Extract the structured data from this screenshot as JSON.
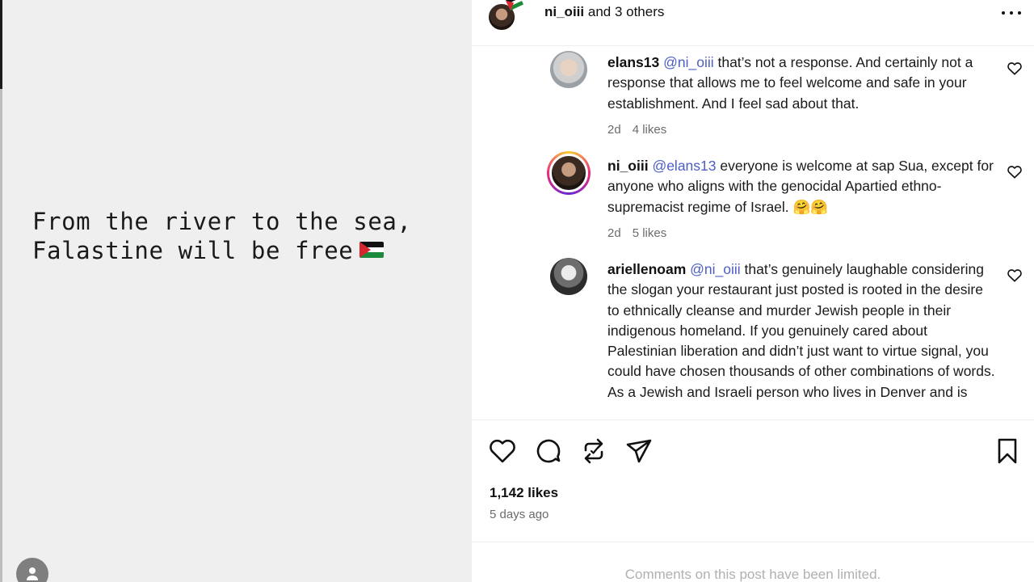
{
  "media": {
    "quote_line1": "From the river to the sea,",
    "quote_line2": "Falastine will be free"
  },
  "header": {
    "username": "ni_oiii",
    "suffix": "and 3 others"
  },
  "comments": [
    {
      "username": "elans13",
      "mention": "@ni_oiii",
      "text": "that’s not a response. And certainly not a response that allows me to feel welcome and safe in your establishment. And I feel sad about that.",
      "age": "2d",
      "likes": "4 likes"
    },
    {
      "username": "ni_oiii",
      "mention": "@elans13",
      "text": "everyone is welcome at sap Sua, except for anyone who aligns with the genocidal Apartied ethno-supremacist regime of Israel. 🤗🤗",
      "age": "2d",
      "likes": "5 likes"
    },
    {
      "username": "ariellenoam",
      "mention": "@ni_oiii",
      "text": "that’s genuinely laughable considering the slogan your restaurant just posted is rooted in the desire to ethnically cleanse and murder Jewish people in their indigenous homeland. If you genuinely cared about Palestinian liberation and didn’t just want to virtue signal, you could have chosen thousands of other combinations of words. As a Jewish and Israeli person who lives in Denver and is"
    }
  ],
  "post": {
    "likes": "1,142 likes",
    "posted": "5 days ago"
  },
  "footer": {
    "limited_text": "Comments on this post have been limited."
  },
  "colors": {
    "mention": "#4c5ec4",
    "muted": "#6b6b6b",
    "media_bg": "#efeff0"
  }
}
